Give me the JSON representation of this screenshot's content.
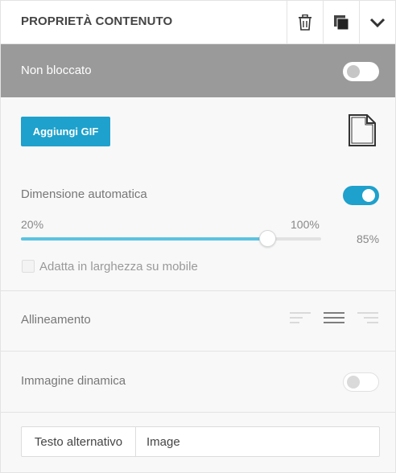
{
  "header": {
    "title": "PROPRIETÀ CONTENUTO",
    "icons": [
      "trash-icon",
      "duplicate-icon",
      "chevron-down-icon"
    ]
  },
  "lock": {
    "label": "Non bloccato",
    "enabled": false
  },
  "gif": {
    "button_label": "Aggiungi GIF",
    "icon": "file-icon"
  },
  "autosize": {
    "label": "Dimensione automatica",
    "enabled": true
  },
  "width_slider": {
    "min_label": "20%",
    "max_label": "100%",
    "value_label": "85%",
    "fraction": 0.82
  },
  "mobile_fit": {
    "label": "Adatta in larghezza su mobile",
    "checked": false
  },
  "alignment": {
    "label": "Allineamento",
    "options": [
      "align-left-icon",
      "align-center-icon",
      "align-right-icon"
    ],
    "selected": "center"
  },
  "dynamic_image": {
    "label": "Immagine dinamica",
    "enabled": false
  },
  "alt_text": {
    "label": "Testo alternativo",
    "value": "Image"
  },
  "colors": {
    "accent": "#1ea1cc",
    "lock_bar": "#9a9a9a"
  }
}
